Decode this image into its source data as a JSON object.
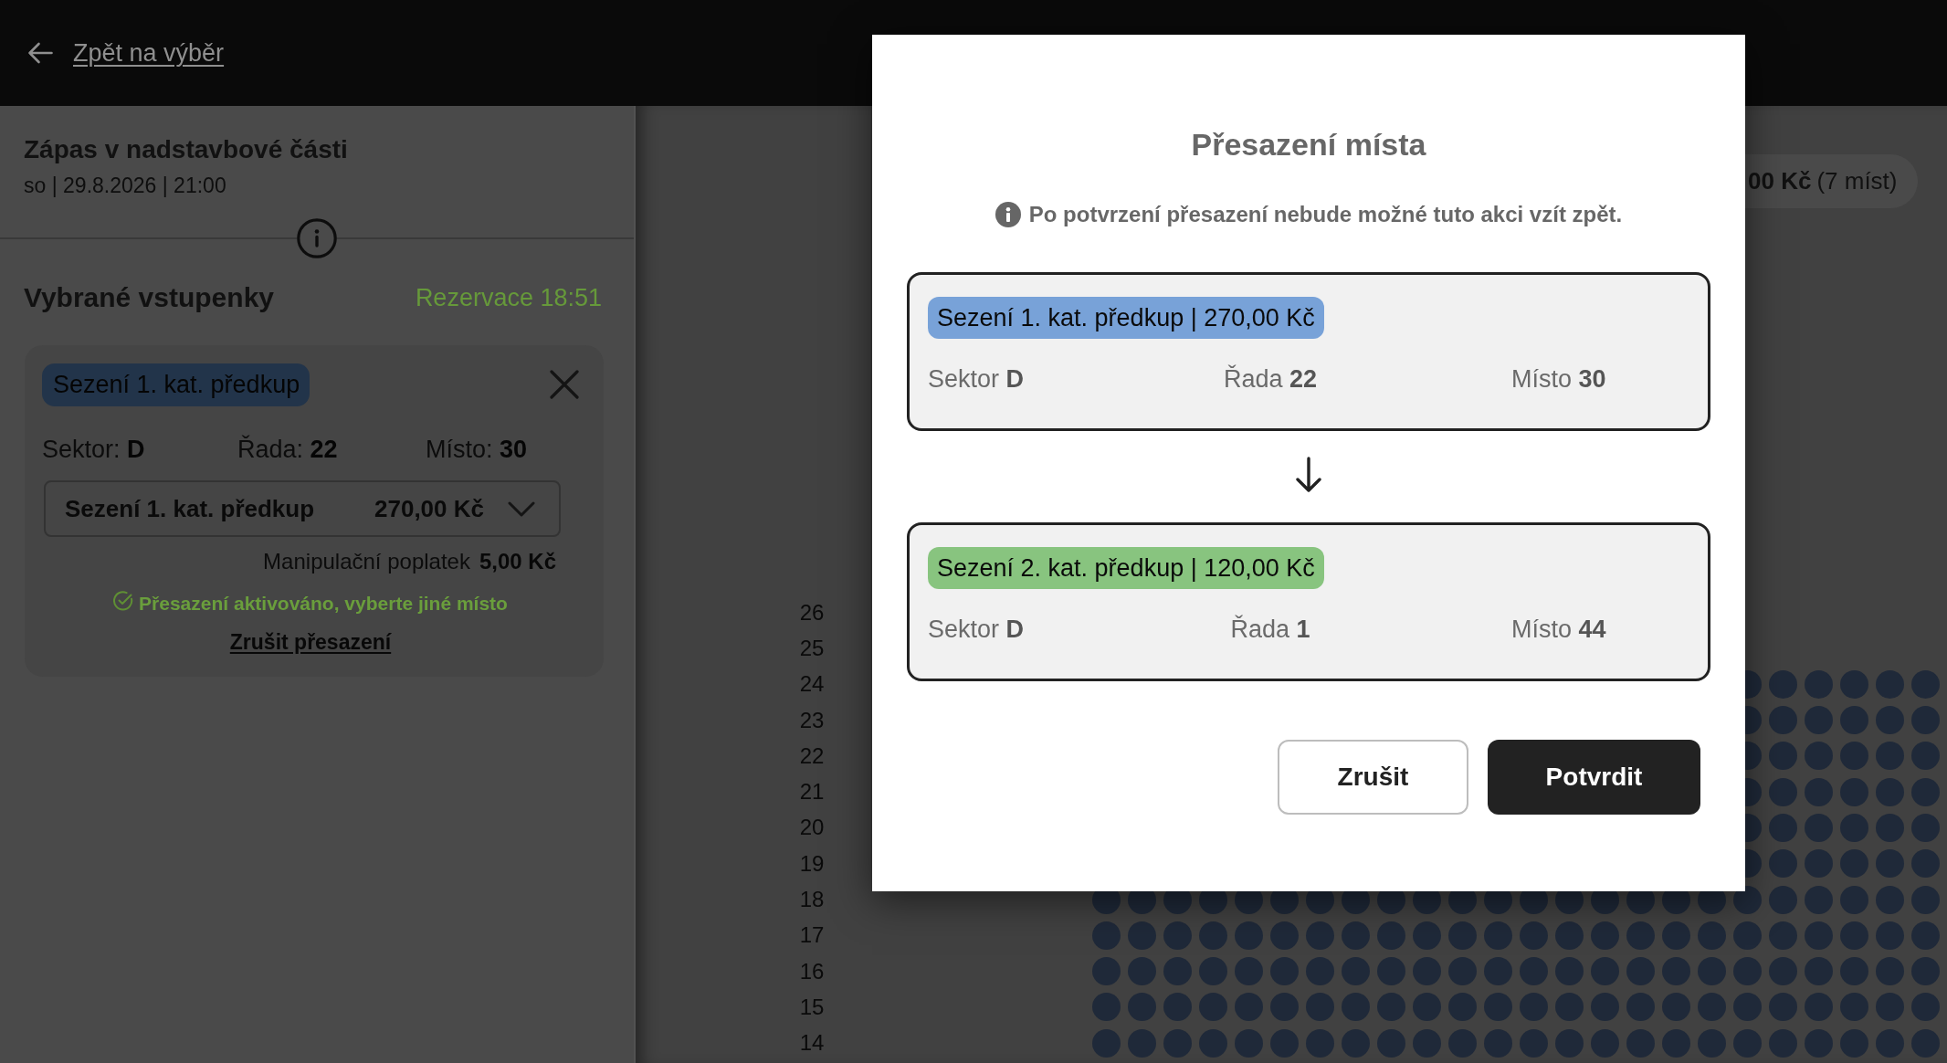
{
  "top_bar": {
    "back_link": "Zpět na výběr"
  },
  "event": {
    "title": "Zápas v nadstavbové části",
    "date": "so | 29.8.2026 | 21:00"
  },
  "cart": {
    "heading": "Vybrané vstupenky",
    "reservation": "Rezervace 18:51",
    "tickets": [
      {
        "category": "Sezení 1. kat. předkup",
        "details": [
          "Sektor: **D**",
          "Řada: **22**",
          "Místo: **30**"
        ],
        "price_option": {
          "name": "Sezení 1. kat. předkup",
          "price": "270,00 Kč"
        },
        "fee": {
          "label": "Manipulační poplatek",
          "amount": "5,00 Kč"
        },
        "status": "Přesazení aktivováno, vyberte jiné místo",
        "cancel_link": "Zrušit přesazení"
      }
    ]
  },
  "seat_map": {
    "summary": "**00 Kč** (7 míst)",
    "rows": [
      {
        "label": "26",
        "kind": "empty"
      },
      {
        "label": "25",
        "kind": "empty"
      },
      {
        "label": "24",
        "kind": "right"
      },
      {
        "label": "23",
        "kind": "right"
      },
      {
        "label": "22",
        "kind": "right"
      },
      {
        "label": "21",
        "kind": "right"
      },
      {
        "label": "20",
        "kind": "right"
      },
      {
        "label": "19",
        "kind": "right"
      },
      {
        "label": "18",
        "kind": "full"
      },
      {
        "label": "17",
        "kind": "full"
      },
      {
        "label": "16",
        "kind": "full"
      },
      {
        "label": "15",
        "kind": "full"
      },
      {
        "label": "14",
        "kind": "full"
      }
    ]
  },
  "dialog": {
    "title": "Přesazení místa",
    "warning": "Po potvrzení přesazení nebude možné tuto akci vzít zpět.",
    "seats": [
      {
        "category": "Sezení 1. kat. předkup | 270,00 Kč",
        "color": "#78a2d8",
        "details": [
          "Sektor **D**",
          "Řada **22**",
          "Místo **30**"
        ]
      },
      {
        "category": "Sezení 2. kat. předkup | 120,00 Kč",
        "color": "#88c47f",
        "details": [
          "Sektor **D**",
          "Řada **1**",
          "Místo **44**"
        ]
      }
    ],
    "buttons": [
      {
        "label": "Zrušit",
        "kind": "secondary"
      },
      {
        "label": "Potvrdit",
        "kind": "primary"
      }
    ]
  }
}
